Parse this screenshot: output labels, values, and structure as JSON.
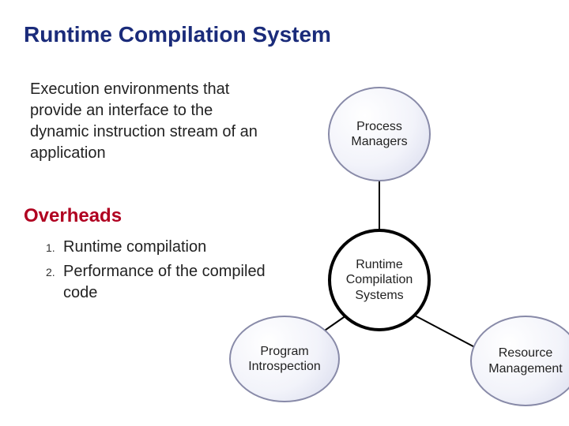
{
  "title": "Runtime Compilation System",
  "intro": "Execution environments that provide an interface to the dynamic instruction stream of an application",
  "subheading": "Overheads",
  "list": {
    "items": [
      {
        "num": "1.",
        "text": "Runtime compilation"
      },
      {
        "num": "2.",
        "text": "Performance of the compiled code"
      }
    ]
  },
  "diagram": {
    "center": "Runtime Compilation Systems",
    "top": "Process Managers",
    "bottom_left": "Program Introspection",
    "bottom_right": "Resource Management"
  }
}
